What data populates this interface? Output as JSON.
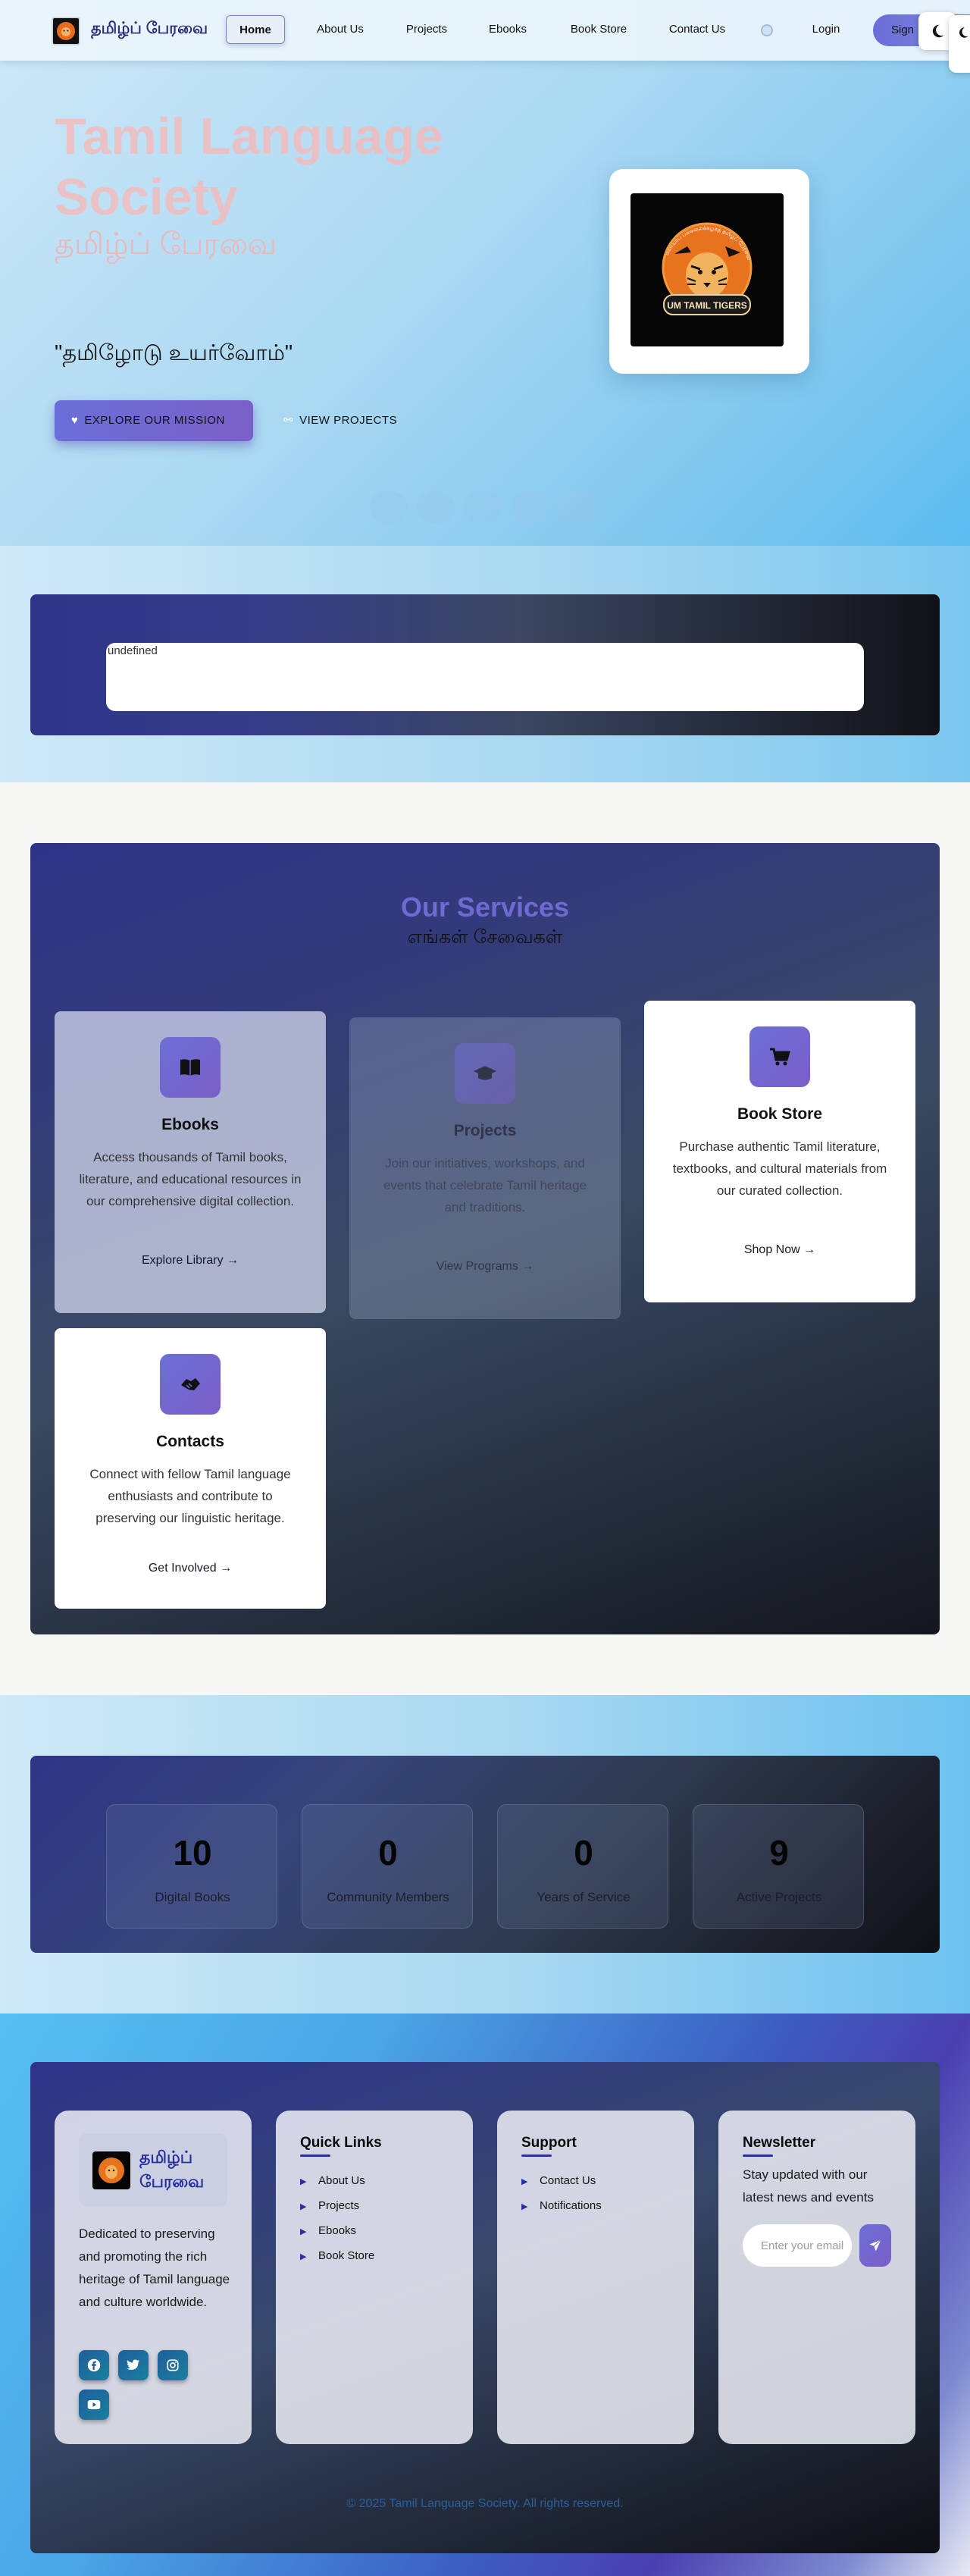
{
  "nav": {
    "brand": "தமிழ்ப் பேரவை",
    "links": [
      "Home",
      "About Us",
      "Projects",
      "Ebooks",
      "Book Store",
      "Contact Us"
    ],
    "login": "Login",
    "signup": "Sign",
    "theme_icon": "moon-icon"
  },
  "hero": {
    "title": "Tamil Language Society",
    "subtitle": "தமிழ்ப் பேரவை",
    "quote": "\"தமிழோடு உயர்வோம்\"",
    "primary_button": "EXPLORE OUR MISSION",
    "secondary_button": "VIEW PROJECTS",
    "logo_text": "UM TAMIL TIGERS",
    "logo_arc_text": "மலாயாப் பல்கலைக்கழகத் தமிழ்ப் பேரவை"
  },
  "video": {
    "alt_text": "undefined"
  },
  "services": {
    "title": "Our Services",
    "subtitle": "எங்கள் சேவைகள்",
    "cards": [
      {
        "title": "Ebooks",
        "desc": "Access thousands of Tamil books, literature, and educational resources in our comprehensive digital collection.",
        "link": "Explore Library",
        "icon": "book-icon"
      },
      {
        "title": "Projects",
        "desc": "Join our initiatives, workshops, and events that celebrate Tamil heritage and traditions.",
        "link": "View Programs",
        "icon": "graduation-cap-icon"
      },
      {
        "title": "Book Store",
        "desc": "Purchase authentic Tamil literature, textbooks, and cultural materials from our curated collection.",
        "link": "Shop Now",
        "icon": "cart-icon"
      },
      {
        "title": "Contacts",
        "desc": "Connect with fellow Tamil language enthusiasts and contribute to preserving our linguistic heritage.",
        "link": "Get Involved",
        "icon": "handshake-icon"
      }
    ]
  },
  "stats": [
    {
      "value": "10",
      "label": "Digital Books"
    },
    {
      "value": "0",
      "label": "Community Members"
    },
    {
      "value": "0",
      "label": "Years of Service"
    },
    {
      "value": "9",
      "label": "Active Projects"
    }
  ],
  "footer": {
    "brand": "தமிழ்ப் பேரவை",
    "about": "Dedicated to preserving and promoting the rich heritage of Tamil language and culture worldwide.",
    "socials": [
      "facebook-icon",
      "twitter-icon",
      "instagram-icon",
      "youtube-icon"
    ],
    "quick_links_title": "Quick Links",
    "quick_links": [
      "About Us",
      "Projects",
      "Ebooks",
      "Book Store"
    ],
    "support_title": "Support",
    "support_links": [
      "Contact Us",
      "Notifications"
    ],
    "newsletter_title": "Newsletter",
    "newsletter_text": "Stay updated with our latest news and events",
    "newsletter_placeholder": "Enter your email",
    "copyright": "© 2025 Tamil Language Society. All rights reserved."
  },
  "colors": {
    "accent": "#6f6ad2",
    "brand": "#2b2b7a",
    "panel_dark": "#2f3387"
  }
}
